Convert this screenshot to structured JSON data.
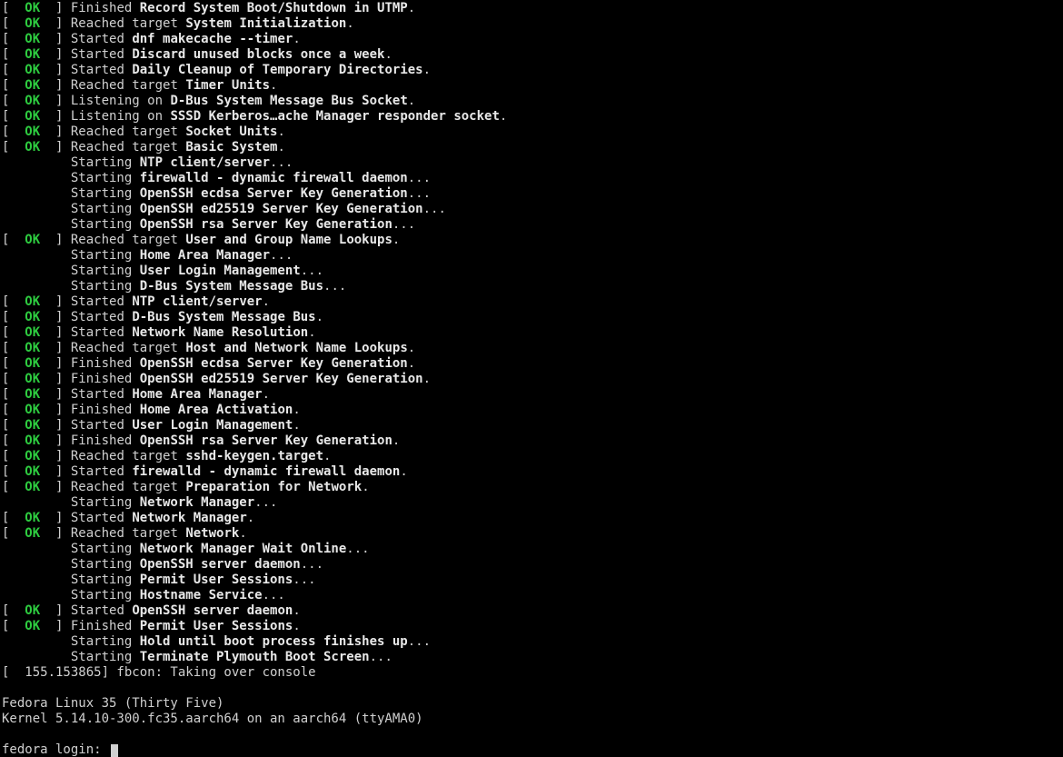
{
  "colors": {
    "ok": "#2ecc40",
    "fg": "#d0d0d0",
    "bg": "#000000",
    "bold": "#e8e8e8"
  },
  "tokens": {
    "lbracket": "[",
    "rbracket": "]",
    "ok": "OK",
    "ellipsis": "...",
    "dot": "."
  },
  "actions": {
    "finished": "Finished",
    "reached_target": "Reached target",
    "started": "Started",
    "listening_on": "Listening on",
    "starting": "Starting"
  },
  "lines": [
    {
      "status": "OK",
      "action": "Finished",
      "subject": "Record System Boot/Shutdown in UTMP",
      "trailer": "."
    },
    {
      "status": "OK",
      "action": "Reached target",
      "subject": "System Initialization",
      "trailer": "."
    },
    {
      "status": "OK",
      "action": "Started",
      "subject": "dnf makecache --timer",
      "trailer": "."
    },
    {
      "status": "OK",
      "action": "Started",
      "subject": "Discard unused blocks once a week",
      "trailer": "."
    },
    {
      "status": "OK",
      "action": "Started",
      "subject": "Daily Cleanup of Temporary Directories",
      "trailer": "."
    },
    {
      "status": "OK",
      "action": "Reached target",
      "subject": "Timer Units",
      "trailer": "."
    },
    {
      "status": "OK",
      "action": "Listening on",
      "subject": "D-Bus System Message Bus Socket",
      "trailer": "."
    },
    {
      "status": "OK",
      "action": "Listening on",
      "subject": "SSSD Kerberos…ache Manager responder socket",
      "trailer": "."
    },
    {
      "status": "OK",
      "action": "Reached target",
      "subject": "Socket Units",
      "trailer": "."
    },
    {
      "status": "OK",
      "action": "Reached target",
      "subject": "Basic System",
      "trailer": "."
    },
    {
      "status": null,
      "action": "Starting",
      "subject": "NTP client/server",
      "trailer": "..."
    },
    {
      "status": null,
      "action": "Starting",
      "subject": "firewalld - dynamic firewall daemon",
      "trailer": "..."
    },
    {
      "status": null,
      "action": "Starting",
      "subject": "OpenSSH ecdsa Server Key Generation",
      "trailer": "..."
    },
    {
      "status": null,
      "action": "Starting",
      "subject": "OpenSSH ed25519 Server Key Generation",
      "trailer": "..."
    },
    {
      "status": null,
      "action": "Starting",
      "subject": "OpenSSH rsa Server Key Generation",
      "trailer": "..."
    },
    {
      "status": "OK",
      "action": "Reached target",
      "subject": "User and Group Name Lookups",
      "trailer": "."
    },
    {
      "status": null,
      "action": "Starting",
      "subject": "Home Area Manager",
      "trailer": "..."
    },
    {
      "status": null,
      "action": "Starting",
      "subject": "User Login Management",
      "trailer": "..."
    },
    {
      "status": null,
      "action": "Starting",
      "subject": "D-Bus System Message Bus",
      "trailer": "..."
    },
    {
      "status": "OK",
      "action": "Started",
      "subject": "NTP client/server",
      "trailer": "."
    },
    {
      "status": "OK",
      "action": "Started",
      "subject": "D-Bus System Message Bus",
      "trailer": "."
    },
    {
      "status": "OK",
      "action": "Started",
      "subject": "Network Name Resolution",
      "trailer": "."
    },
    {
      "status": "OK",
      "action": "Reached target",
      "subject": "Host and Network Name Lookups",
      "trailer": "."
    },
    {
      "status": "OK",
      "action": "Finished",
      "subject": "OpenSSH ecdsa Server Key Generation",
      "trailer": "."
    },
    {
      "status": "OK",
      "action": "Finished",
      "subject": "OpenSSH ed25519 Server Key Generation",
      "trailer": "."
    },
    {
      "status": "OK",
      "action": "Started",
      "subject": "Home Area Manager",
      "trailer": "."
    },
    {
      "status": "OK",
      "action": "Finished",
      "subject": "Home Area Activation",
      "trailer": "."
    },
    {
      "status": "OK",
      "action": "Started",
      "subject": "User Login Management",
      "trailer": "."
    },
    {
      "status": "OK",
      "action": "Finished",
      "subject": "OpenSSH rsa Server Key Generation",
      "trailer": "."
    },
    {
      "status": "OK",
      "action": "Reached target",
      "subject": "sshd-keygen.target",
      "trailer": "."
    },
    {
      "status": "OK",
      "action": "Started",
      "subject": "firewalld - dynamic firewall daemon",
      "trailer": "."
    },
    {
      "status": "OK",
      "action": "Reached target",
      "subject": "Preparation for Network",
      "trailer": "."
    },
    {
      "status": null,
      "action": "Starting",
      "subject": "Network Manager",
      "trailer": "..."
    },
    {
      "status": "OK",
      "action": "Started",
      "subject": "Network Manager",
      "trailer": "."
    },
    {
      "status": "OK",
      "action": "Reached target",
      "subject": "Network",
      "trailer": "."
    },
    {
      "status": null,
      "action": "Starting",
      "subject": "Network Manager Wait Online",
      "trailer": "..."
    },
    {
      "status": null,
      "action": "Starting",
      "subject": "OpenSSH server daemon",
      "trailer": "..."
    },
    {
      "status": null,
      "action": "Starting",
      "subject": "Permit User Sessions",
      "trailer": "..."
    },
    {
      "status": null,
      "action": "Starting",
      "subject": "Hostname Service",
      "trailer": "..."
    },
    {
      "status": "OK",
      "action": "Started",
      "subject": "OpenSSH server daemon",
      "trailer": "."
    },
    {
      "status": "OK",
      "action": "Finished",
      "subject": "Permit User Sessions",
      "trailer": "."
    },
    {
      "status": null,
      "action": "Starting",
      "subject": "Hold until boot process finishes up",
      "trailer": "..."
    },
    {
      "status": null,
      "action": "Starting",
      "subject": "Terminate Plymouth Boot Screen",
      "trailer": "..."
    }
  ],
  "kmsg": "[  155.153865] fbcon: Taking over console",
  "distro_line": "Fedora Linux 35 (Thirty Five)",
  "kernel_line": "Kernel 5.14.10-300.fc35.aarch64 on an aarch64 (ttyAMA0)",
  "login_prompt": "fedora login: "
}
